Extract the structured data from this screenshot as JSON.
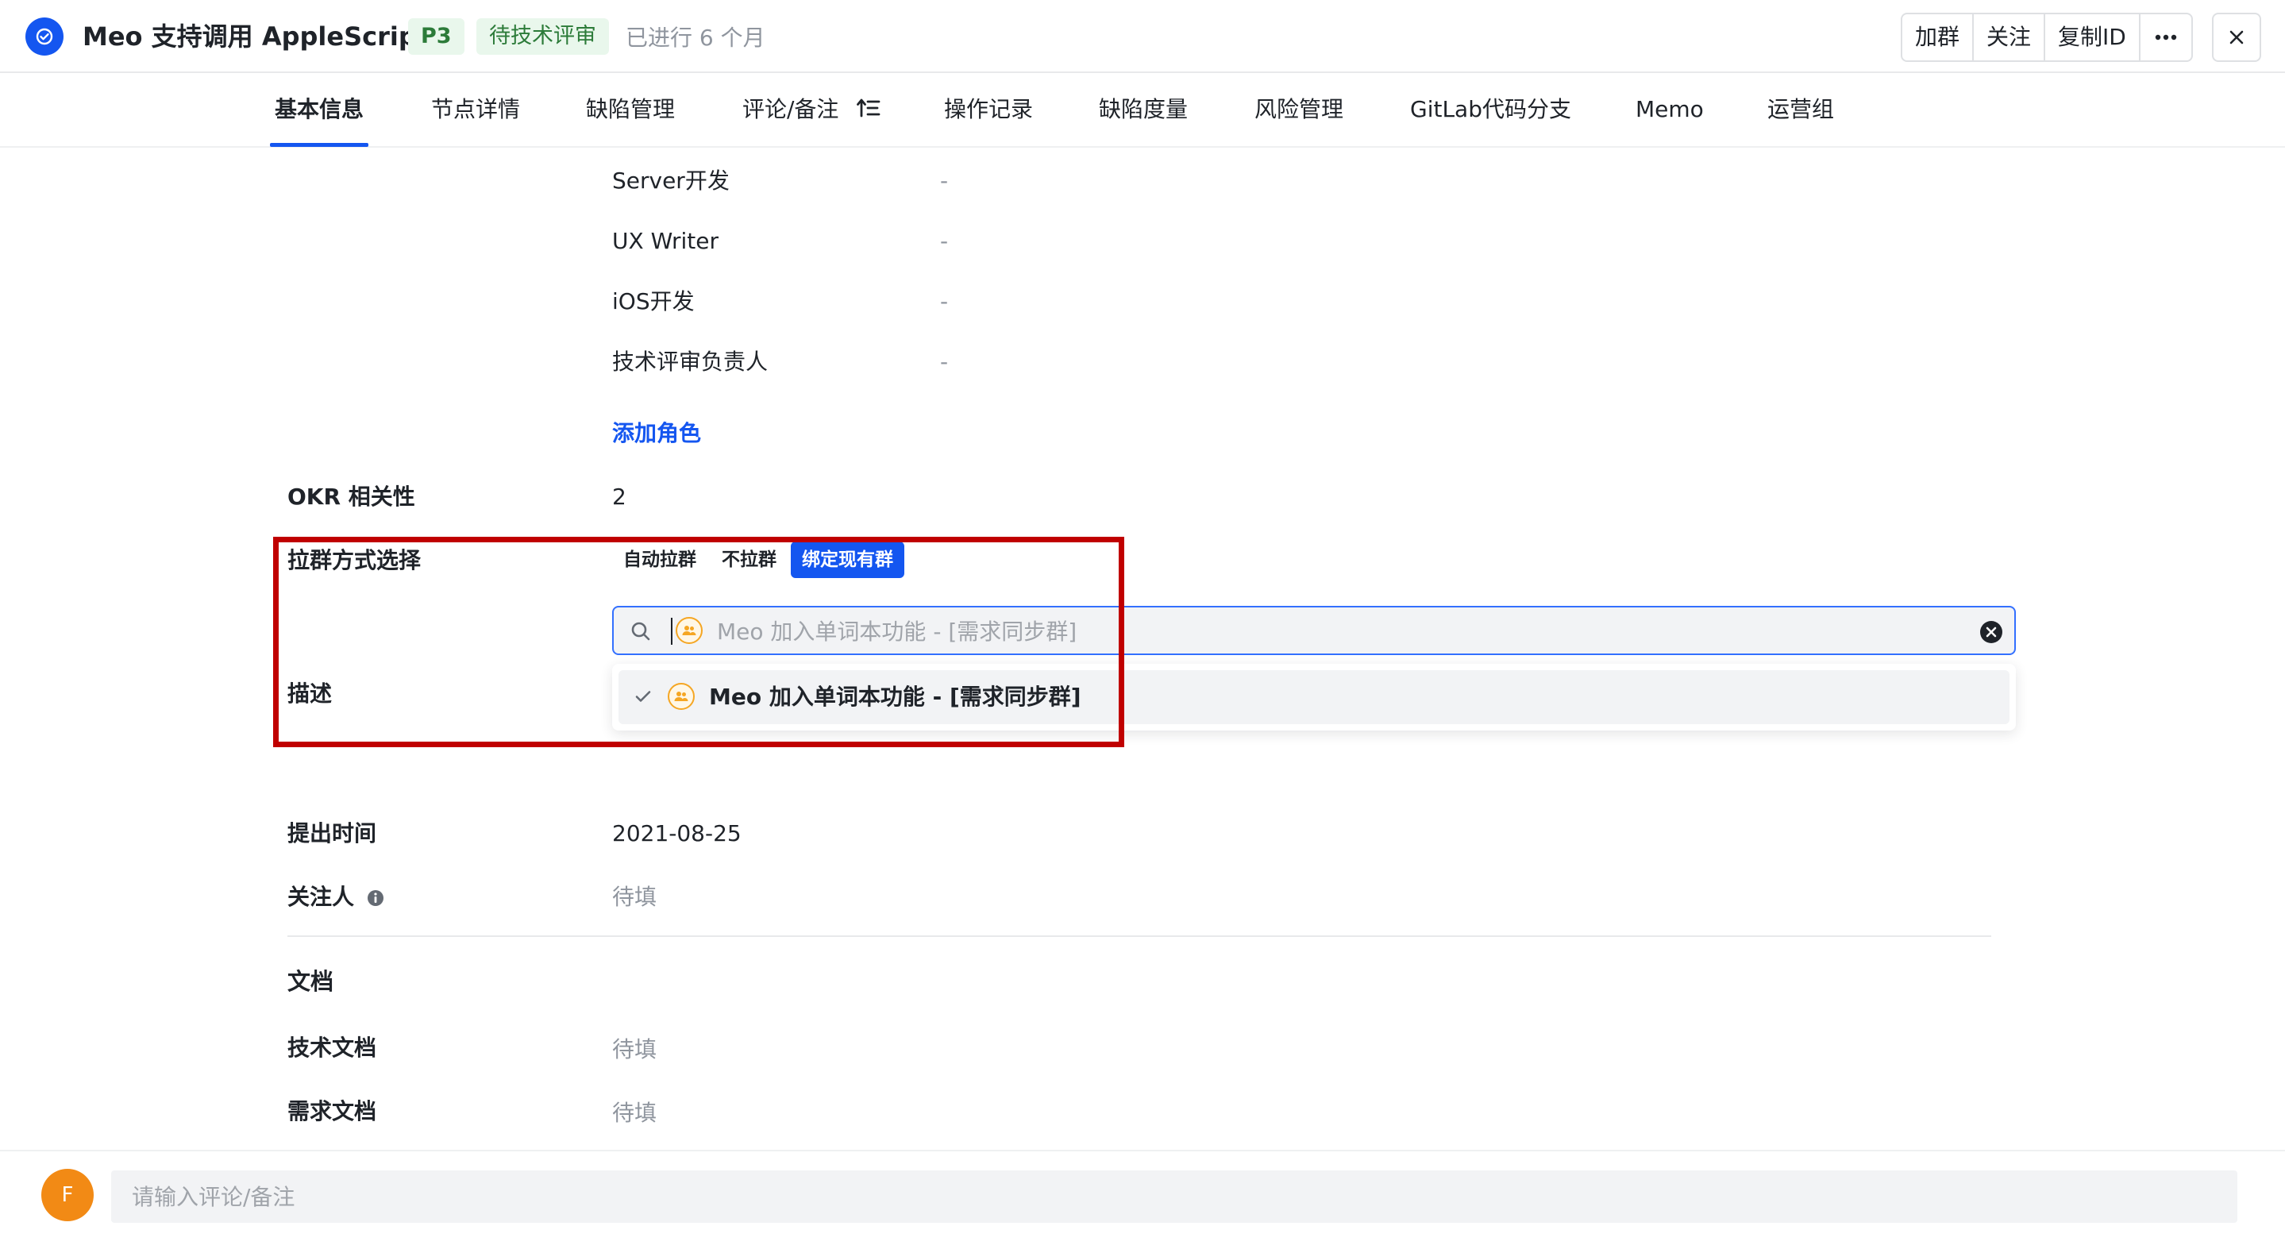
{
  "header": {
    "title": "Meo 支持调用 AppleScript",
    "priority": "P3",
    "status": "待技术评审",
    "elapsed": "已进行 6 个月",
    "actions": [
      "加群",
      "关注",
      "复制ID"
    ],
    "more_icon": "more-icon",
    "close_icon": "close-icon"
  },
  "tabs": [
    {
      "label": "基本信息",
      "active": true
    },
    {
      "label": "节点详情"
    },
    {
      "label": "缺陷管理"
    },
    {
      "label": "评论/备注"
    },
    {
      "label": "操作记录"
    },
    {
      "label": "缺陷度量"
    },
    {
      "label": "风险管理"
    },
    {
      "label": "GitLab代码分支"
    },
    {
      "label": "Memo"
    },
    {
      "label": "运营组"
    }
  ],
  "roles": [
    {
      "name": "Server开发",
      "value": "-"
    },
    {
      "name": "UX Writer",
      "value": "-"
    },
    {
      "name": "iOS开发",
      "value": "-"
    },
    {
      "name": "技术评审负责人",
      "value": "-"
    }
  ],
  "add_role": "添加角色",
  "okr": {
    "label": "OKR 相关性",
    "value": "2"
  },
  "group_mode": {
    "label": "拉群方式选择",
    "options": [
      "自动拉群",
      "不拉群",
      "绑定现有群"
    ],
    "selected": "绑定现有群"
  },
  "group_search": {
    "placeholder": "Meo 加入单词本功能 - [需求同步群]",
    "value": ""
  },
  "group_dropdown": {
    "items": [
      {
        "label": "Meo 加入单词本功能 - [需求同步群]",
        "checked": true
      }
    ]
  },
  "description": {
    "label": "描述"
  },
  "submit_time": {
    "label": "提出时间",
    "value": "2021-08-25"
  },
  "followers": {
    "label": "关注人",
    "value": "待填"
  },
  "docs": {
    "title": "文档",
    "tech": {
      "label": "技术文档",
      "value": "待填"
    },
    "req": {
      "label": "需求文档",
      "value": "待填"
    }
  },
  "comment": {
    "avatar_initial": "F",
    "placeholder": "请输入评论/备注"
  },
  "colors": {
    "accent": "#1456f0",
    "highlight": "#c00000",
    "badge_green": "#2c7b39"
  }
}
